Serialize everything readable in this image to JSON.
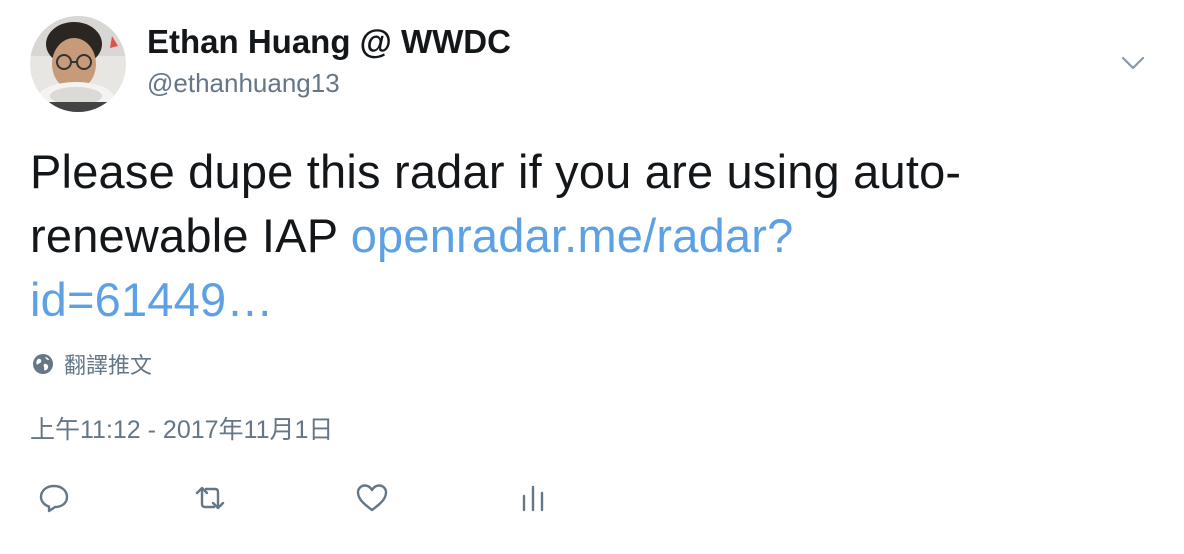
{
  "author": {
    "display_name": "Ethan Huang @ WWDC",
    "username": "@ethanhuang13"
  },
  "tweet": {
    "text_before_link": "Please dupe this radar if you are using auto-renewable IAP ",
    "link_line1": "openradar.me/radar?",
    "link_line2": "id=61449…",
    "translate_label": "翻譯推文",
    "timestamp": "上午11:12 - 2017年11月1日"
  },
  "icons": {
    "caret": "chevron-down-icon",
    "globe": "globe-icon",
    "reply": "reply-icon",
    "retweet": "retweet-icon",
    "like": "heart-icon",
    "analytics": "analytics-icon"
  },
  "colors": {
    "text": "#14171a",
    "secondary": "#657786",
    "link": "#5da1e4",
    "icon": "#657786"
  }
}
